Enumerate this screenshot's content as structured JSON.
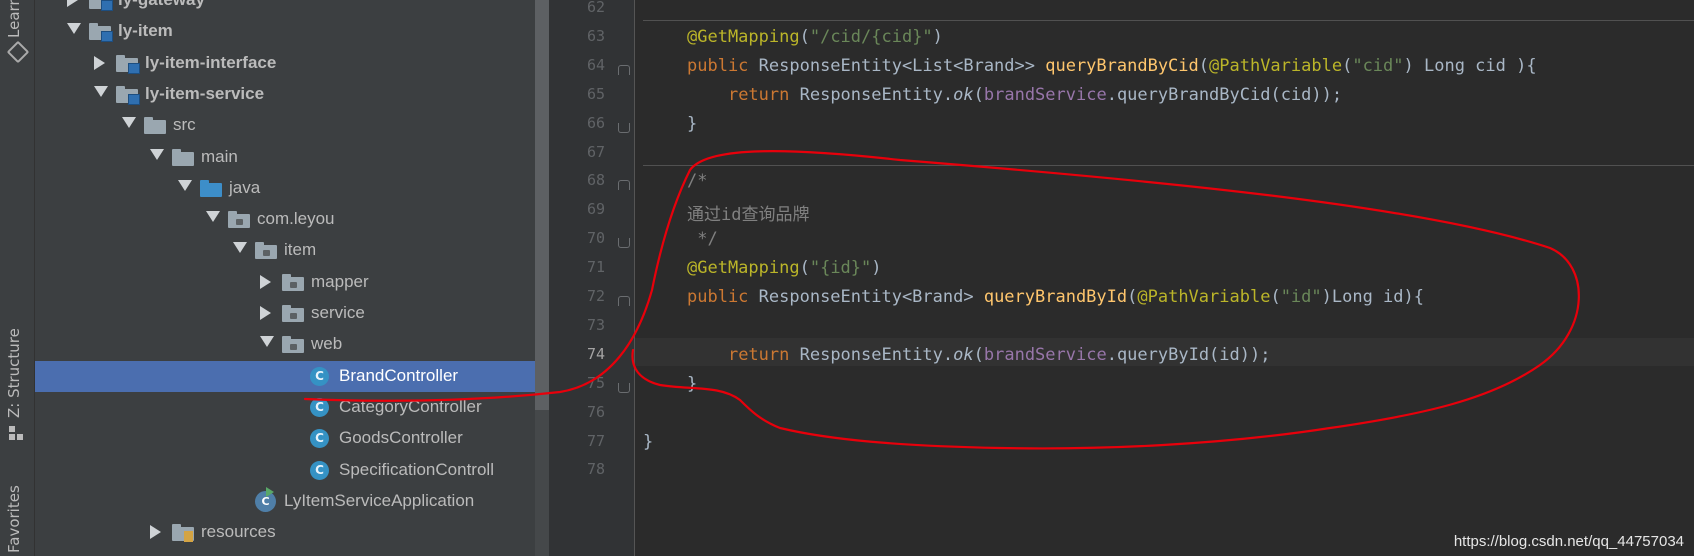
{
  "side_tabs": {
    "learn": "Learn",
    "structure": "Z: Structure",
    "favorites": "Favorites"
  },
  "project_tree": [
    {
      "label": "ly-gateway",
      "icon": "module-folder-icon",
      "arrow": "right",
      "bold": true
    },
    {
      "label": "ly-item",
      "icon": "module-folder-icon",
      "arrow": "down",
      "bold": true
    },
    {
      "label": "ly-item-interface",
      "icon": "module-folder-icon",
      "arrow": "right",
      "bold": true
    },
    {
      "label": "ly-item-service",
      "icon": "module-folder-icon",
      "arrow": "down",
      "bold": true
    },
    {
      "label": "src",
      "icon": "folder-icon",
      "arrow": "down"
    },
    {
      "label": "main",
      "icon": "folder-icon",
      "arrow": "down"
    },
    {
      "label": "java",
      "icon": "source-folder-icon",
      "arrow": "down"
    },
    {
      "label": "com.leyou",
      "icon": "package-icon",
      "arrow": "down"
    },
    {
      "label": "item",
      "icon": "package-icon",
      "arrow": "down"
    },
    {
      "label": "mapper",
      "icon": "package-icon",
      "arrow": "right"
    },
    {
      "label": "service",
      "icon": "package-icon",
      "arrow": "right"
    },
    {
      "label": "web",
      "icon": "package-icon",
      "arrow": "down"
    },
    {
      "label": "BrandController",
      "icon": "java-class-icon",
      "selected": true
    },
    {
      "label": "CategoryController",
      "icon": "java-class-icon"
    },
    {
      "label": "GoodsController",
      "icon": "java-class-icon"
    },
    {
      "label": "SpecificationControll",
      "icon": "java-class-icon"
    },
    {
      "label": "LyItemServiceApplication",
      "icon": "spring-boot-app-icon"
    },
    {
      "label": "resources",
      "icon": "resources-folder-icon",
      "arrow": "right"
    }
  ],
  "editor": {
    "current_line": "74",
    "lines": [
      {
        "num": "62",
        "tokens": []
      },
      {
        "num": "63",
        "tokens": [
          [
            "an",
            "@GetMapping"
          ],
          [
            "",
            "("
          ],
          [
            "str",
            "\"/cid/{cid}\""
          ],
          [
            "",
            ")"
          ]
        ]
      },
      {
        "num": "64",
        "tokens": [
          [
            "kw",
            "public "
          ],
          [
            "",
            "ResponseEntity<List<Brand>> "
          ],
          [
            "fn",
            "queryBrandByCid"
          ],
          [
            "",
            "("
          ],
          [
            "an",
            "@PathVariable"
          ],
          [
            "",
            "("
          ],
          [
            "str",
            "\"cid\""
          ],
          [
            "",
            ") Long cid ){"
          ]
        ]
      },
      {
        "num": "65",
        "tokens": [
          [
            "",
            "    "
          ],
          [
            "kw",
            "return "
          ],
          [
            "",
            "ResponseEntity."
          ],
          [
            "it",
            "ok"
          ],
          [
            "",
            "("
          ],
          [
            "field",
            "brandService"
          ],
          [
            "",
            ".queryBrandByCid(cid));"
          ]
        ]
      },
      {
        "num": "66",
        "tokens": [
          [
            "",
            "}"
          ]
        ]
      },
      {
        "num": "67",
        "tokens": []
      },
      {
        "num": "68",
        "tokens": [
          [
            "cmt",
            "/*"
          ]
        ]
      },
      {
        "num": "69",
        "tokens": [
          [
            "cmt",
            "通过id查询品牌"
          ]
        ]
      },
      {
        "num": "70",
        "tokens": [
          [
            "cmt",
            " */"
          ]
        ]
      },
      {
        "num": "71",
        "tokens": [
          [
            "an",
            "@GetMapping"
          ],
          [
            "",
            "("
          ],
          [
            "str",
            "\"{id}\""
          ],
          [
            "",
            ")"
          ]
        ]
      },
      {
        "num": "72",
        "tokens": [
          [
            "kw",
            "public "
          ],
          [
            "",
            "ResponseEntity<Brand> "
          ],
          [
            "fn",
            "queryBrandById"
          ],
          [
            "",
            "("
          ],
          [
            "an",
            "@PathVariable"
          ],
          [
            "",
            "("
          ],
          [
            "str",
            "\"id\""
          ],
          [
            "",
            ")Long id){"
          ]
        ]
      },
      {
        "num": "73",
        "tokens": []
      },
      {
        "num": "74",
        "tokens": [
          [
            "",
            "    "
          ],
          [
            "kw",
            "return "
          ],
          [
            "",
            "ResponseEntity."
          ],
          [
            "it",
            "ok"
          ],
          [
            "",
            "("
          ],
          [
            "field",
            "brandService"
          ],
          [
            "",
            ".queryById(id));"
          ]
        ]
      },
      {
        "num": "75",
        "tokens": [
          [
            "",
            "}"
          ]
        ]
      },
      {
        "num": "76",
        "tokens": []
      },
      {
        "num": "77",
        "tokens": [
          [
            "",
            "}"
          ]
        ]
      },
      {
        "num": "78",
        "tokens": []
      }
    ]
  },
  "watermark": "https://blog.csdn.net/qq_44757034",
  "colors": {
    "annotation_red": "#e8000b",
    "selection": "#4b6eaf"
  }
}
